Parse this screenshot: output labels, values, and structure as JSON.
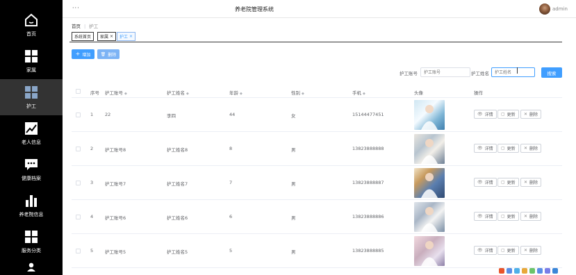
{
  "header": {
    "dots": "···",
    "title": "养老院管理系统",
    "user": "admin"
  },
  "sidebar": {
    "items": [
      {
        "label": "首页",
        "icon": "home-icon"
      },
      {
        "label": "家属",
        "icon": "grid-icon"
      },
      {
        "label": "护工",
        "icon": "grid-icon",
        "active": true
      },
      {
        "label": "老人信息",
        "icon": "trend-chart-icon"
      },
      {
        "label": "健康档案",
        "icon": "chat-icon"
      },
      {
        "label": "养老院信息",
        "icon": "bar-chart-icon"
      },
      {
        "label": "服务分类",
        "icon": "grid-icon"
      },
      {
        "label": "",
        "icon": "user-icon"
      }
    ]
  },
  "breadcrumb": {
    "home": "首页",
    "current": "护工"
  },
  "tabs": [
    {
      "label": "系统首页",
      "closable": false
    },
    {
      "label": "家属",
      "closable": true
    },
    {
      "label": "护工",
      "closable": true,
      "active": true
    }
  ],
  "toolbar": {
    "add": "增加",
    "delete": "删除"
  },
  "search": {
    "account_label": "护工账号",
    "account_placeholder": "护工账号",
    "name_label": "护工姓名",
    "name_placeholder": "护工姓名",
    "button": "搜索"
  },
  "table": {
    "headers": [
      "序号",
      "护工账号",
      "护工姓名",
      "年龄",
      "性别",
      "手机",
      "头像",
      "操作"
    ],
    "rows": [
      {
        "index": "1",
        "account": "22",
        "name": "李四",
        "age": "44",
        "gender": "女",
        "phone": "15144477451"
      },
      {
        "index": "2",
        "account": "护工账号8",
        "name": "护工姓名8",
        "age": "8",
        "gender": "男",
        "phone": "13823888888"
      },
      {
        "index": "3",
        "account": "护工账号7",
        "name": "护工姓名7",
        "age": "7",
        "gender": "男",
        "phone": "13823888887"
      },
      {
        "index": "4",
        "account": "护工账号6",
        "name": "护工姓名6",
        "age": "6",
        "gender": "男",
        "phone": "13823888886"
      },
      {
        "index": "5",
        "account": "护工账号5",
        "name": "护工姓名5",
        "age": "5",
        "gender": "男",
        "phone": "13823888885"
      }
    ],
    "actions": {
      "detail": "详情",
      "update": "更新",
      "delete": "删除"
    }
  },
  "colors": {
    "sidebar_bg": "#000000",
    "sidebar_active": "#333333",
    "primary": "#409eff"
  }
}
